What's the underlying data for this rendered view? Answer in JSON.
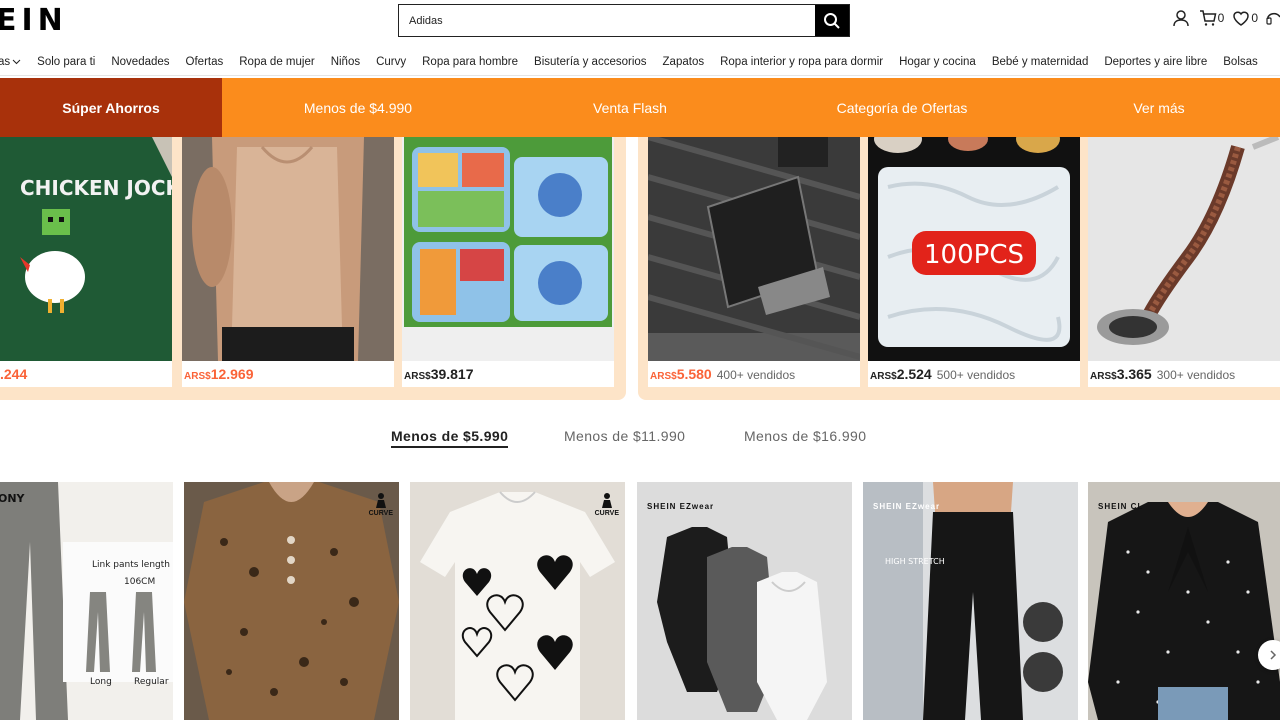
{
  "header": {
    "logo": "EIN",
    "search_value": "Adidas",
    "cart_count": "0",
    "wishlist_count": "0"
  },
  "nav": {
    "items": [
      "as",
      "Solo para ti",
      "Novedades",
      "Ofertas",
      "Ropa de mujer",
      "Niños",
      "Curvy",
      "Ropa para hombre",
      "Bisutería y accesorios",
      "Zapatos",
      "Ropa interior y ropa para dormir",
      "Hogar y cocina",
      "Bebé y maternidad",
      "Deportes y aire libre",
      "Bolsas"
    ]
  },
  "promo": {
    "tabs": [
      "Súper Ahorros",
      "Menos de $4.990",
      "Venta Flash",
      "Categoría de Ofertas",
      "Ver más"
    ]
  },
  "deals": [
    {
      "currency": "",
      "price": ".244",
      "sold": ""
    },
    {
      "currency": "ARS$",
      "price": "12.969",
      "sold": ""
    },
    {
      "currency": "ARS$",
      "price": "39.817",
      "sold": ""
    },
    {
      "currency": "ARS$",
      "price": "5.580",
      "sold": "400+ vendidos"
    },
    {
      "currency": "ARS$",
      "price": "2.524",
      "sold": "500+ vendidos"
    },
    {
      "currency": "ARS$",
      "price": "3.365",
      "sold": "300+ vendidos"
    }
  ],
  "deal_image_texts": {
    "shirt": "CHICKEN JOCKEY",
    "cover": "100PCS"
  },
  "price_tabs": [
    "Menos de $5.990",
    "Menos de $11.990",
    "Menos de $16.990"
  ],
  "products": {
    "pants_label": "Link pants length",
    "pants_length": "106CM",
    "pants_long": "Long",
    "pants_regular": "Regular",
    "brand_tag": "ONY",
    "curve_badge": "CURVE",
    "ezwear": "SHEIN EZwear",
    "high_stretch": "HIGH STRETCH",
    "shein_cl": "SHEIN CL"
  },
  "colors": {
    "accent": "#fb8c1c",
    "active_tab": "#a8310b",
    "price_red": "#fa6338"
  }
}
